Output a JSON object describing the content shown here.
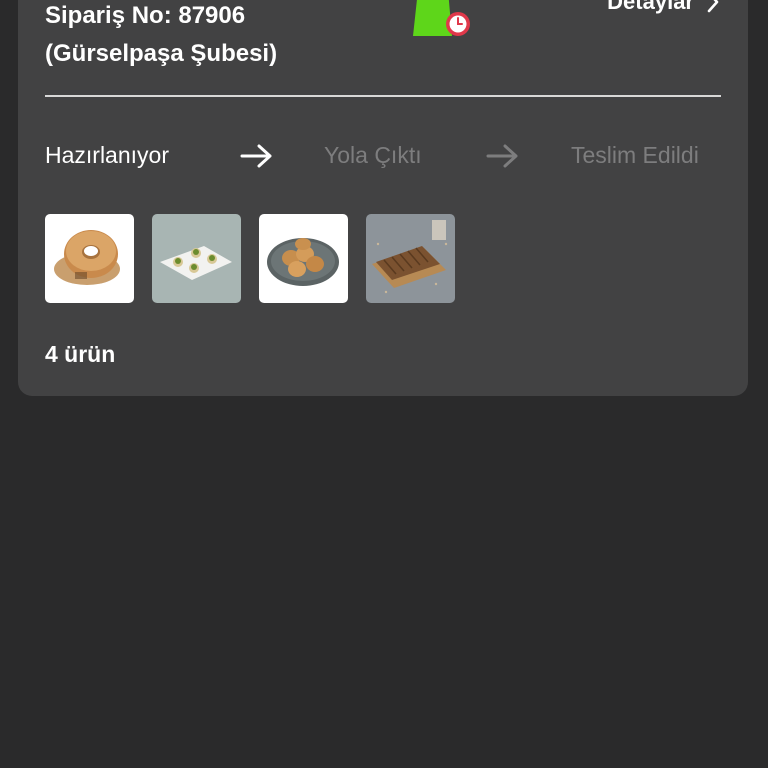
{
  "order": {
    "number_label": "Sipariş No: 87906",
    "branch_label": "(Gürselpaşa Şubesi)",
    "details_label": "Detaylar"
  },
  "status_steps": [
    {
      "label": "Hazırlanıyor",
      "state": "active"
    },
    {
      "label": "Yola Çıktı",
      "state": "inactive"
    },
    {
      "label": "Teslim Edildi",
      "state": "inactive"
    }
  ],
  "products": [
    {
      "name": "bagel-product",
      "icon": "bagel-image"
    },
    {
      "name": "pistachio-pastry-product",
      "icon": "pistachio-pastry-image"
    },
    {
      "name": "cookie-plate-product",
      "icon": "cookie-plate-image"
    },
    {
      "name": "sliced-bread-product",
      "icon": "sliced-bread-image"
    }
  ],
  "item_count_label": "4 ürün",
  "colors": {
    "background": "#2a2a2b",
    "card": "#424243",
    "text_active": "#ffffff",
    "text_inactive": "#7d7d7e",
    "bag_green": "#5ed61a",
    "clock_red": "#e0384a"
  }
}
